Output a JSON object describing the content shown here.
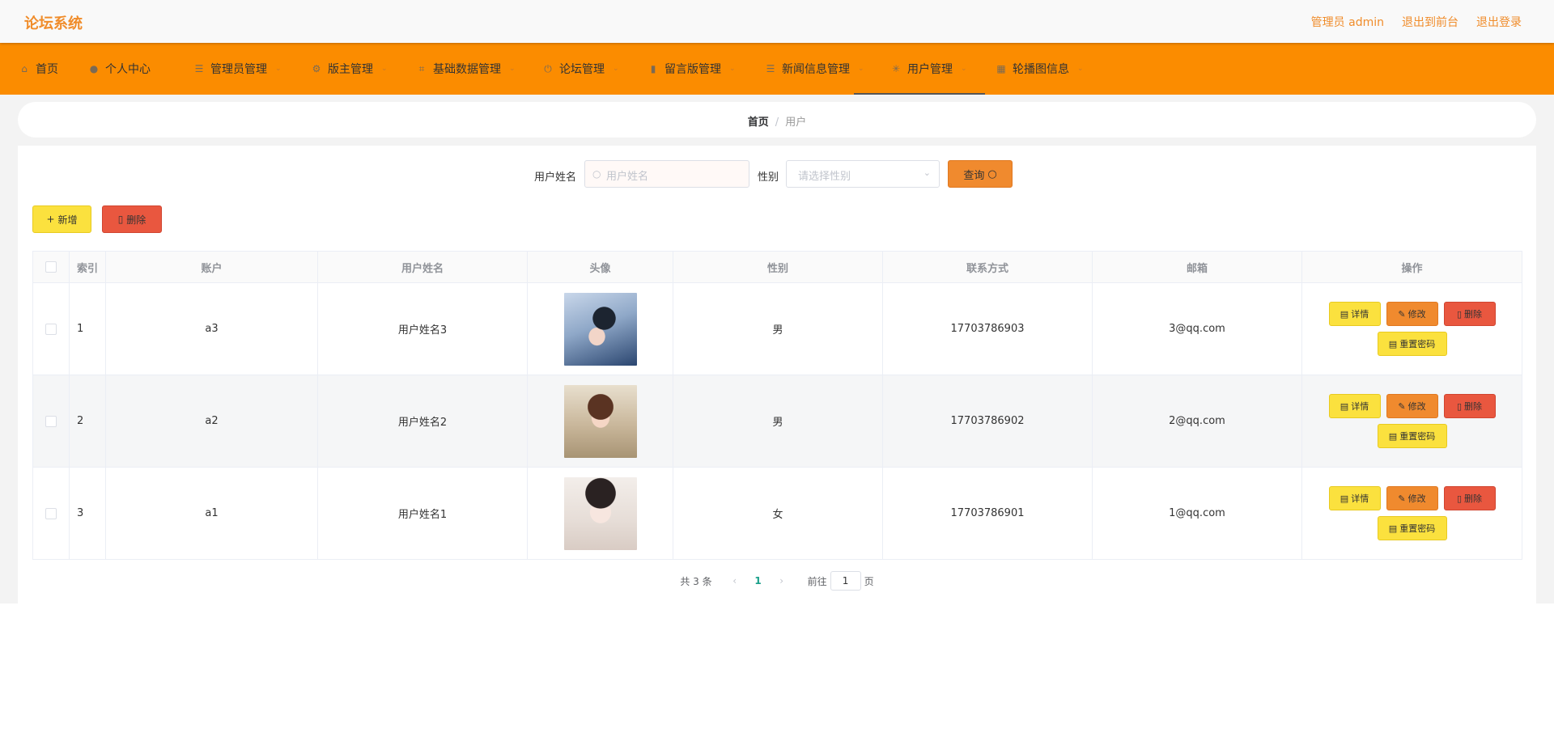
{
  "app": {
    "title": "论坛系统"
  },
  "top_links": {
    "admin": "管理员 admin",
    "to_front": "退出到前台",
    "logout": "退出登录"
  },
  "nav": [
    {
      "label": "首页",
      "icon": "home-icon"
    },
    {
      "label": "个人中心",
      "icon": "user-icon"
    },
    {
      "label": "管理员管理",
      "icon": "list-icon"
    },
    {
      "label": "版主管理",
      "icon": "setting-icon"
    },
    {
      "label": "基础数据管理",
      "icon": "crop-icon"
    },
    {
      "label": "论坛管理",
      "icon": "power-icon"
    },
    {
      "label": "留言版管理",
      "icon": "chart-icon"
    },
    {
      "label": "新闻信息管理",
      "icon": "list-icon"
    },
    {
      "label": "用户管理",
      "icon": "loading-icon"
    },
    {
      "label": "轮播图信息",
      "icon": "grid-icon"
    }
  ],
  "breadcrumb": {
    "home": "首页",
    "separator": "/",
    "current": "用户"
  },
  "search": {
    "name_label": "用户姓名",
    "name_placeholder": "用户姓名",
    "gender_label": "性别",
    "gender_placeholder": "请选择性别",
    "query_label": "查询"
  },
  "actions": {
    "add": "新增",
    "delete": "删除"
  },
  "table": {
    "headers": [
      "索引",
      "账户",
      "用户姓名",
      "头像",
      "性别",
      "联系方式",
      "邮箱",
      "操作"
    ],
    "rows": [
      {
        "index": "1",
        "account": "a3",
        "name": "用户姓名3",
        "gender": "男",
        "phone": "17703786903",
        "email": "3@qq.com"
      },
      {
        "index": "2",
        "account": "a2",
        "name": "用户姓名2",
        "gender": "男",
        "phone": "17703786902",
        "email": "2@qq.com"
      },
      {
        "index": "3",
        "account": "a1",
        "name": "用户姓名1",
        "gender": "女",
        "phone": "17703786901",
        "email": "1@qq.com"
      }
    ],
    "ops": {
      "detail": "详情",
      "edit": "修改",
      "delete": "删除",
      "reset": "重置密码"
    }
  },
  "pagination": {
    "total": "共 3 条",
    "current_page": "1",
    "goto_prefix": "前往",
    "goto_value": "1",
    "goto_suffix": "页"
  },
  "colors": {
    "accent": "#fb8c00",
    "title": "#f08c2a",
    "yellow_btn": "#fbe13e",
    "orange_btn": "#f08a2e",
    "red_btn": "#e9573f"
  }
}
